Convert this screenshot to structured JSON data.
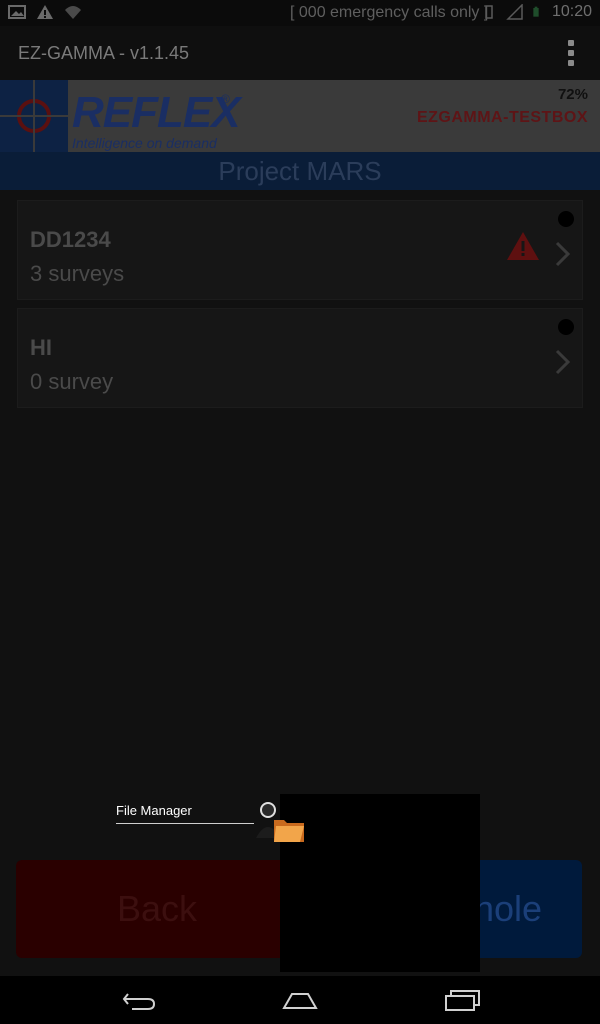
{
  "status_bar": {
    "emergency_text": "[ 000 emergency calls only ]",
    "time": "10:20"
  },
  "action_bar": {
    "title": "EZ-GAMMA - v1.1.45"
  },
  "brand": {
    "logo_text": "REFLEX",
    "logo_tagline": "Intelligence on demand",
    "battery": "72%",
    "device_name": "EZGAMMA-TESTBOX"
  },
  "project": {
    "title": "Project MARS"
  },
  "holes": [
    {
      "name": "DD1234",
      "surveys": "3 surveys",
      "warning": true
    },
    {
      "name": "HI",
      "surveys": "0 survey",
      "warning": false
    }
  ],
  "buttons": {
    "back": "Back",
    "hole": "hole"
  },
  "overlay": {
    "file_manager_label": "File Manager"
  },
  "colors": {
    "back_button": "#2a0000",
    "hole_button": "#001a3c",
    "project_band": "#0a1d38",
    "device_name": "#5e1416"
  }
}
